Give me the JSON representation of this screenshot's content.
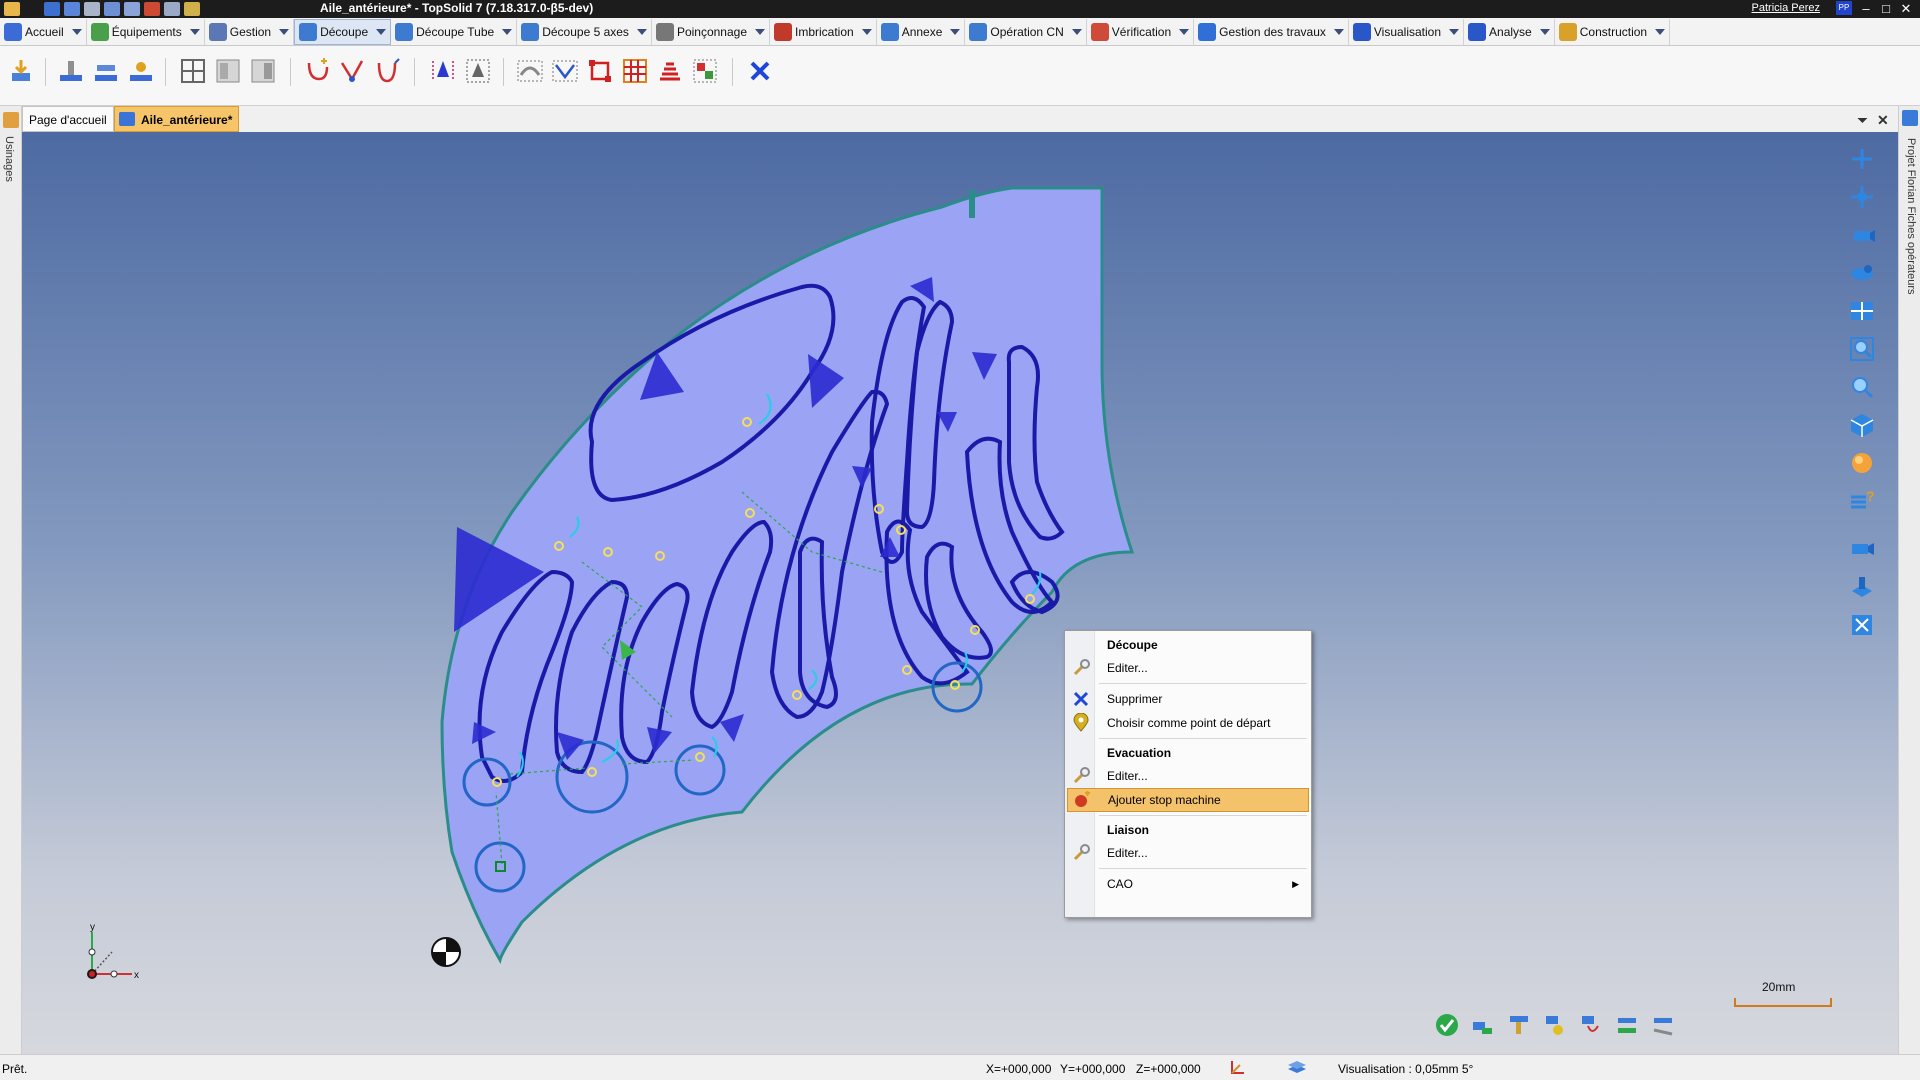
{
  "window": {
    "title": "Aile_antérieure* - TopSolid 7 (7.18.317.0-β5-dev)",
    "user": "Patricia Perez",
    "user_initials": "PP",
    "controls": [
      "–",
      "□",
      "✕"
    ]
  },
  "ribbon": {
    "tabs": [
      {
        "label": "Accueil",
        "icon": "home-icon",
        "color": "#3b6bd6"
      },
      {
        "label": "Équipements",
        "icon": "equipment-icon",
        "color": "#4aa04a"
      },
      {
        "label": "Gestion",
        "icon": "management-icon",
        "color": "#5b77b5"
      },
      {
        "label": "Découpe",
        "icon": "cutting-icon",
        "color": "#3c7bd0",
        "active": true
      },
      {
        "label": "Découpe Tube",
        "icon": "tube-cutting-icon",
        "color": "#3c7bd0"
      },
      {
        "label": "Découpe 5 axes",
        "icon": "five-axis-cutting-icon",
        "color": "#3c7bd0"
      },
      {
        "label": "Poinçonnage",
        "icon": "punching-icon",
        "color": "#777777"
      },
      {
        "label": "Imbrication",
        "icon": "nesting-icon",
        "color": "#c0392b"
      },
      {
        "label": "Annexe",
        "icon": "annex-icon",
        "color": "#3c7bd0"
      },
      {
        "label": "Opération CN",
        "icon": "cn-operation-icon",
        "color": "#3c7bd0"
      },
      {
        "label": "Vérification",
        "icon": "verification-icon",
        "color": "#d04a3a"
      },
      {
        "label": "Gestion des travaux",
        "icon": "jobs-icon",
        "color": "#2f6fd6"
      },
      {
        "label": "Visualisation",
        "icon": "visualization-icon",
        "color": "#2a57c8"
      },
      {
        "label": "Analyse",
        "icon": "analysis-icon",
        "color": "#2a57c8"
      },
      {
        "label": "Construction",
        "icon": "construction-icon",
        "color": "#d9a02a"
      }
    ]
  },
  "documents": {
    "tabs": [
      {
        "label": "Page d'accueil",
        "active": false
      },
      {
        "label": "Aile_antérieure*",
        "active": true
      }
    ]
  },
  "side_panels": {
    "left": "Usinages",
    "right": "Projet Florian Fiches opérateurs"
  },
  "context_menu": {
    "items": [
      {
        "type": "header",
        "label": "Découpe"
      },
      {
        "type": "item",
        "label": "Editer...",
        "icon": "wrench-icon"
      },
      {
        "type": "separator"
      },
      {
        "type": "item",
        "label": "Supprimer",
        "icon": "delete-x-icon"
      },
      {
        "type": "item",
        "label": "Choisir comme point de départ",
        "icon": "location-pin-icon"
      },
      {
        "type": "separator"
      },
      {
        "type": "header",
        "label": "Evacuation"
      },
      {
        "type": "item",
        "label": "Editer...",
        "icon": "wrench-icon"
      },
      {
        "type": "item",
        "label": "Ajouter stop machine",
        "icon": "stop-machine-icon",
        "highlighted": true
      },
      {
        "type": "separator"
      },
      {
        "type": "header",
        "label": "Liaison"
      },
      {
        "type": "item",
        "label": "Editer...",
        "icon": "wrench-icon"
      },
      {
        "type": "separator"
      },
      {
        "type": "item",
        "label": "CAO",
        "submenu": true
      }
    ]
  },
  "viewport": {
    "scale_label": "20mm",
    "axis_x": "x",
    "axis_y": "y",
    "colors": {
      "part_fill": "#9aa3f4",
      "part_edge": "#2a8d8a",
      "toolpath": "#1a1aa8",
      "direction_arrow": "#2b2bd0",
      "lead": "#22d0e8"
    }
  },
  "status": {
    "state": "Prêt.",
    "x": "X=+000,000",
    "y": "Y=+000,000",
    "z": "Z=+000,000",
    "visualisation": "Visualisation : 0,05mm 5°"
  }
}
